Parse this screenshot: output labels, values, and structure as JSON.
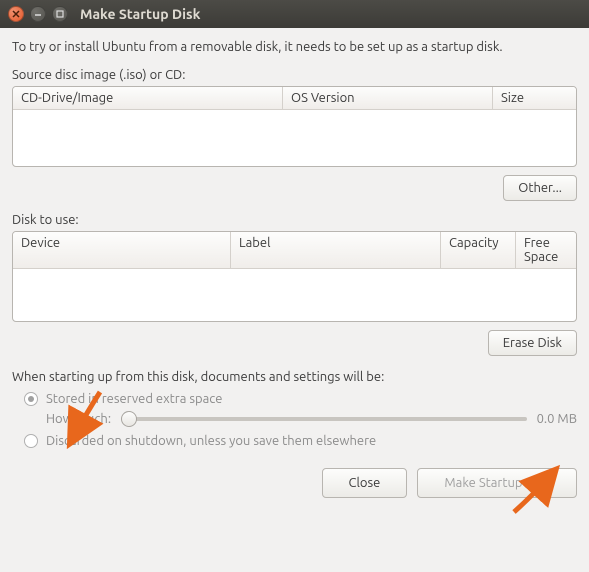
{
  "window": {
    "title": "Make Startup Disk"
  },
  "intro": "To try or install Ubuntu from a removable disk, it needs to be set up as a startup disk.",
  "source": {
    "label": "Source disc image (.iso) or CD:",
    "columns": [
      "CD-Drive/Image",
      "OS Version",
      "Size"
    ],
    "other_button": "Other..."
  },
  "disk": {
    "label": "Disk to use:",
    "columns": [
      "Device",
      "Label",
      "Capacity",
      "Free Space"
    ],
    "erase_button": "Erase Disk"
  },
  "persistence": {
    "intro": "When starting up from this disk, documents and settings will be:",
    "option_stored": "Stored in reserved extra space",
    "how_much_label": "How much:",
    "value": "0.0 MB",
    "option_discarded": "Discarded on shutdown, unless you save them elsewhere"
  },
  "footer": {
    "close": "Close",
    "make": "Make Startup Disk"
  },
  "annotations": {
    "arrow_color": "#e8671c"
  }
}
